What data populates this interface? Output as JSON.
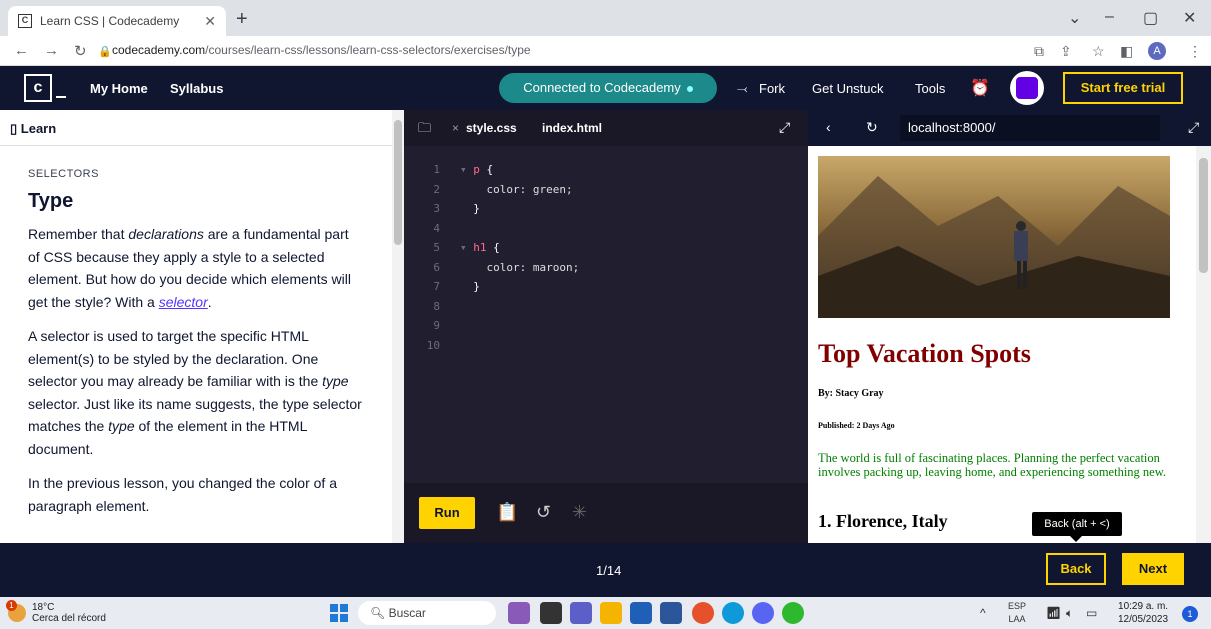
{
  "browser": {
    "tab_title": "Learn CSS | Codecademy",
    "tab_favicon": "C",
    "url_host": "codecademy.com",
    "url_path": "/courses/learn-css/lessons/learn-css-selectors/exercises/type",
    "profile_initial": "A"
  },
  "header": {
    "logo": "c",
    "nav": [
      "My Home",
      "Syllabus"
    ],
    "connected": "Connected to Codecademy",
    "fork": "Fork",
    "get_unstuck": "Get Unstuck",
    "tools": "Tools",
    "trial": "Start free trial"
  },
  "learn": {
    "panel_label": "Learn",
    "kicker": "SELECTORS",
    "title": "Type",
    "p1_a": "Remember that ",
    "p1_em": "declarations",
    "p1_b": " are a fundamental part of CSS because they apply a style to a selected element. But how do you decide which elements will get the style? With a ",
    "p1_link": "selector",
    "p1_c": ".",
    "p2_a": "A selector is used to target the specific HTML element(s) to be styled by the declaration. One selector you may already be familiar with is the ",
    "p2_em1": "type",
    "p2_b": " selector. Just like its name suggests, the type selector matches the ",
    "p2_em2": "type",
    "p2_c": " of the element in the HTML document.",
    "p3": "In the previous lesson, you changed the color of a paragraph element."
  },
  "editor": {
    "tabs": [
      "style.css",
      "index.html"
    ],
    "lines": [
      {
        "n": "1",
        "sel": "p",
        "rest": " {"
      },
      {
        "n": "2",
        "text": "    color: green;"
      },
      {
        "n": "3",
        "text": "  }"
      },
      {
        "n": "4",
        "text": ""
      },
      {
        "n": "5",
        "sel": "h1",
        "rest": " {"
      },
      {
        "n": "6",
        "text": "    color: maroon;"
      },
      {
        "n": "7",
        "text": "  }"
      },
      {
        "n": "8",
        "text": ""
      },
      {
        "n": "9",
        "text": ""
      },
      {
        "n": "10",
        "text": ""
      }
    ],
    "run": "Run"
  },
  "preview": {
    "address": "localhost:8000/",
    "heading": "Top Vacation Spots",
    "byline": "By: Stacy Gray",
    "published": "Published: 2 Days Ago",
    "paragraph": "The world is full of fascinating places. Planning the perfect vacation involves packing up, leaving home, and experiencing something new.",
    "city": "1. Florence, Italy",
    "tooltip": "Back (alt + <)"
  },
  "footer": {
    "progress": "1/14",
    "back": "Back",
    "next": "Next"
  },
  "taskbar": {
    "temp": "18°C",
    "weather_desc": "Cerca del récord",
    "weather_badge": "1",
    "search": "Buscar",
    "lang1": "ESP",
    "lang2": "LAA",
    "time": "10:29 a. m.",
    "date": "12/05/2023",
    "notifications": "1"
  },
  "colors": {
    "brand_navy": "#10162f",
    "accent_yellow": "#ffd300",
    "connected_teal": "#1c8a8a",
    "heading_maroon": "#800000",
    "para_green": "#008000"
  }
}
